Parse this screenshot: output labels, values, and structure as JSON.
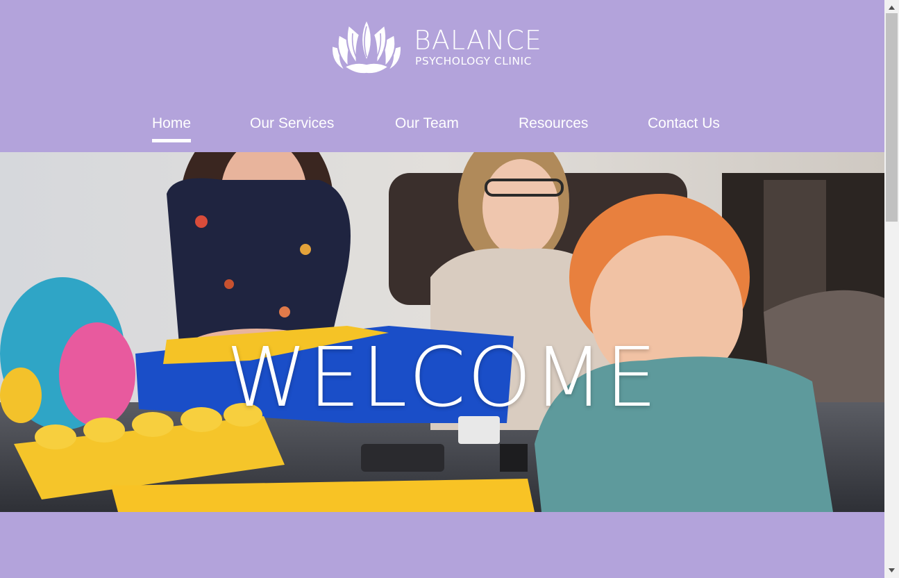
{
  "brand": {
    "name": "BALANCE",
    "tagline": "PSYCHOLOGY CLINIC",
    "icon": "lotus-icon"
  },
  "nav": {
    "items": [
      {
        "label": "Home",
        "active": true
      },
      {
        "label": "Our Services",
        "active": false
      },
      {
        "label": "Our Team",
        "active": false
      },
      {
        "label": "Resources",
        "active": false
      },
      {
        "label": "Contact Us",
        "active": false
      }
    ]
  },
  "hero": {
    "title": "WELCOME",
    "image": "photo of two women and a child playing with building blocks"
  },
  "colors": {
    "background": "#b3a3db",
    "text": "#ffffff",
    "scrollbar_track": "#f1f1f1",
    "scrollbar_thumb": "#c1c1c1"
  },
  "scrollbar": {
    "up_icon": "scroll-up-arrow-icon",
    "down_icon": "scroll-down-arrow-icon"
  }
}
